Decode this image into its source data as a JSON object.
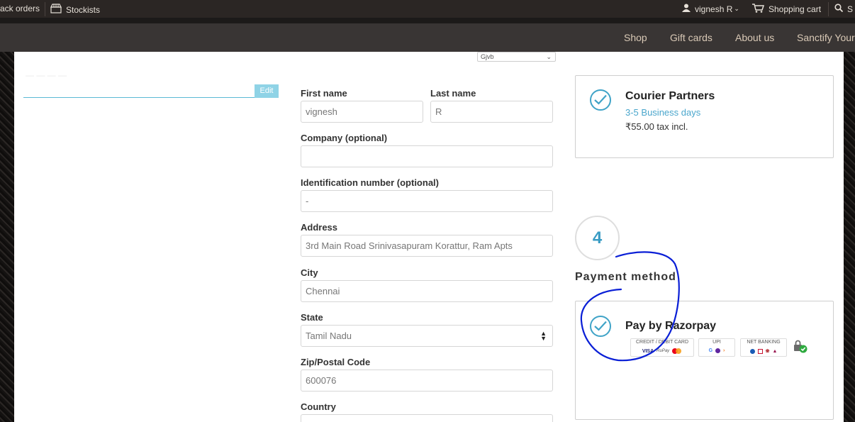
{
  "topbar": {
    "track_orders": "ack orders",
    "stockists": "Stockists",
    "user": "vignesh R",
    "cart": "Shopping cart",
    "search_partial": "S"
  },
  "nav": [
    "Shop",
    "Gift cards",
    "About us",
    "Sanctify Your"
  ],
  "summary": {
    "edit_label": "Edit"
  },
  "form": {
    "mini_select_value": "Gjvb",
    "first_name_label": "First name",
    "first_name_value": "vignesh",
    "last_name_label": "Last name",
    "last_name_value": "R",
    "company_label": "Company (optional)",
    "company_value": "",
    "id_label": "Identification number (optional)",
    "id_value": "-",
    "address_label": "Address",
    "address_value": "3rd Main Road Srinivasapuram Korattur, Ram Apts",
    "city_label": "City",
    "city_value": "Chennai",
    "state_label": "State",
    "state_value": "Tamil Nadu",
    "zip_label": "Zip/Postal Code",
    "zip_value": "600076",
    "country_label": "Country"
  },
  "shipping": {
    "title": "Courier Partners",
    "days": "3-5 Business days",
    "price": "₹55.00 tax incl."
  },
  "payment": {
    "step_number": "4",
    "section_title": "Payment method",
    "option_title": "Pay by Razorpay",
    "card_caption": "CREDIT / DEBIT CARD",
    "upi_caption": "UPI",
    "netbanking_caption": "NET BANKING",
    "visa": "VISA",
    "rupay": "RuPay"
  },
  "colors": {
    "accent": "#3fa3c7",
    "nav_text": "#d9c9b6",
    "annotation": "#0a1fd6"
  }
}
